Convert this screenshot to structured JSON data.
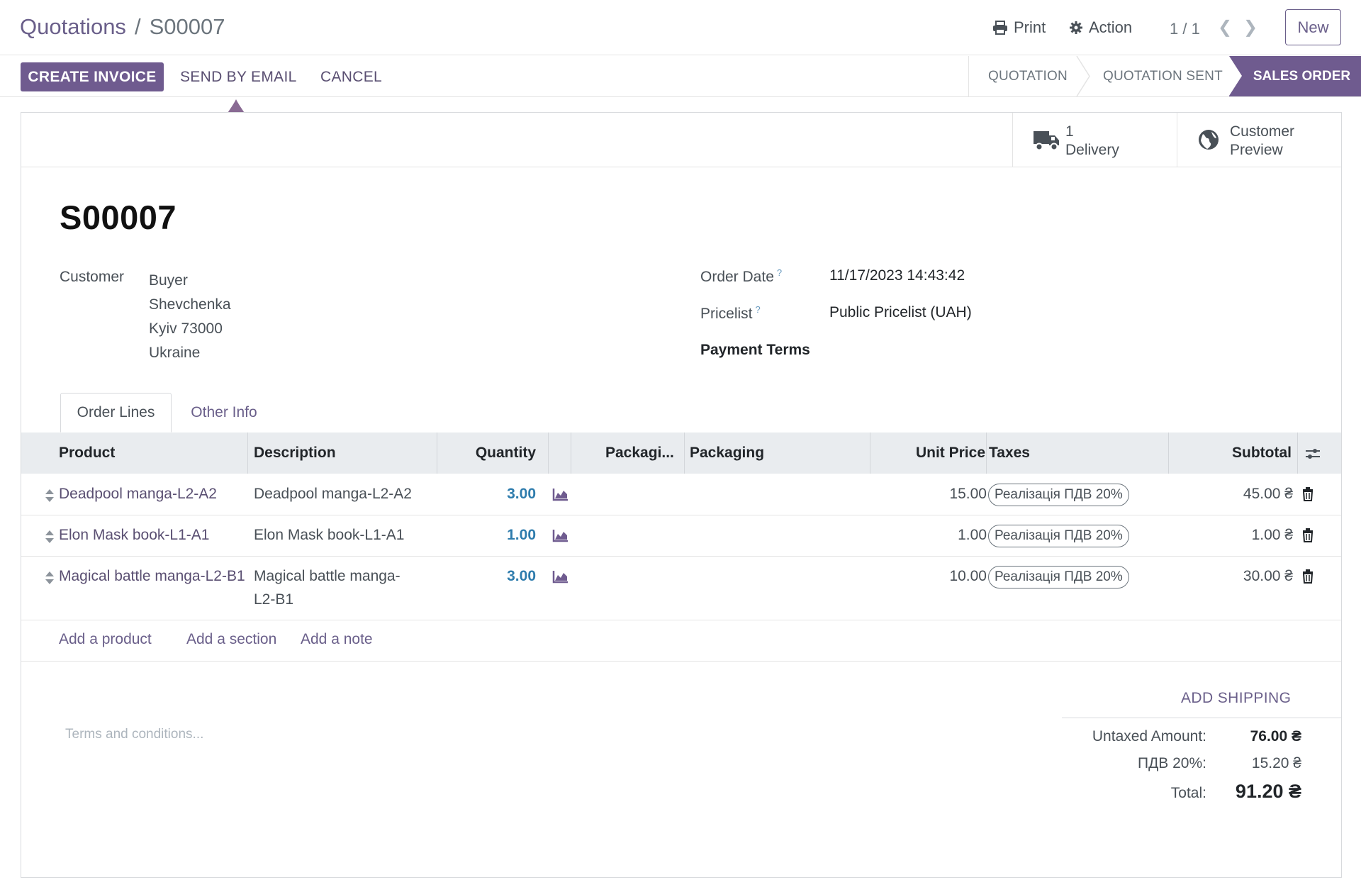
{
  "breadcrumb": {
    "parent": "Quotations",
    "separator": "/",
    "current": "S00007"
  },
  "toolbar": {
    "print": "Print",
    "action": "Action",
    "pager": "1 / 1",
    "new": "New"
  },
  "buttons": {
    "create_invoice": "CREATE INVOICE",
    "send_email": "SEND BY EMAIL",
    "cancel": "CANCEL"
  },
  "status": {
    "steps": [
      "QUOTATION",
      "QUOTATION SENT",
      "SALES ORDER"
    ],
    "active": "SALES ORDER"
  },
  "smart_buttons": {
    "delivery": {
      "count": "1",
      "label": "Delivery"
    },
    "preview": {
      "line1": "Customer",
      "line2": "Preview"
    }
  },
  "order": {
    "name": "S00007",
    "customer_label": "Customer",
    "customer": {
      "name": "Buyer",
      "street": "Shevchenka",
      "city": "Kyiv 73000",
      "country": "Ukraine"
    },
    "date_label": "Order Date",
    "date": "11/17/2023 14:43:42",
    "pricelist_label": "Pricelist",
    "pricelist": "Public Pricelist (UAH)",
    "payment_terms_label": "Payment Terms",
    "help_mark": "?"
  },
  "tabs": {
    "order_lines": "Order Lines",
    "other_info": "Other Info"
  },
  "table": {
    "headers": {
      "product": "Product",
      "description": "Description",
      "quantity": "Quantity",
      "packaging_qty": "Packagi...",
      "packaging": "Packaging",
      "unit_price": "Unit Price",
      "taxes": "Taxes",
      "subtotal": "Subtotal"
    },
    "rows": [
      {
        "product": "Deadpool manga-L2-A2",
        "description": "Deadpool manga-L2-A2",
        "description2": "",
        "quantity": "3.00",
        "unit_price": "15.00",
        "tax": "Реалізація ПДВ 20%",
        "subtotal": "45.00 ₴"
      },
      {
        "product": "Elon Mask book-L1-A1",
        "description": "Elon Mask book-L1-A1",
        "description2": "",
        "quantity": "1.00",
        "unit_price": "1.00",
        "tax": "Реалізація ПДВ 20%",
        "subtotal": "1.00 ₴"
      },
      {
        "product": "Magical battle manga-L2-B1",
        "description": "Magical battle manga-",
        "description2": "L2-B1",
        "quantity": "3.00",
        "unit_price": "10.00",
        "tax": "Реалізація ПДВ 20%",
        "subtotal": "30.00 ₴"
      }
    ],
    "add_product": "Add a product",
    "add_section": "Add a section",
    "add_note": "Add a note"
  },
  "footer": {
    "add_shipping": "ADD SHIPPING",
    "terms_placeholder": "Terms and conditions...",
    "untaxed_label": "Untaxed Amount:",
    "untaxed": "76.00 ₴",
    "tax_label": "ПДВ 20%:",
    "tax": "15.20 ₴",
    "total_label": "Total:",
    "total": "91.20 ₴"
  },
  "colors": {
    "primary": "#6f5b8f",
    "link": "#6a5f8a",
    "quantity": "#2e7cad"
  }
}
